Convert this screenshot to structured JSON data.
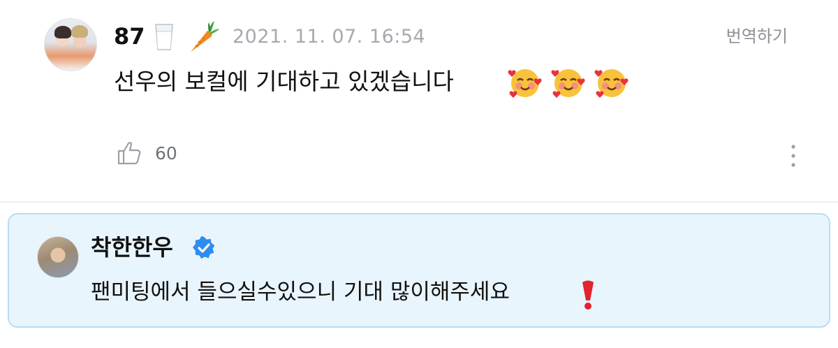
{
  "comment": {
    "author": "87",
    "author_emojis": [
      "milk-glass",
      "carrot"
    ],
    "timestamp": "2021. 11. 07. 16:54",
    "translate_label": "번역하기",
    "text": "선우의 보컬에 기대하고 있겠습니다",
    "text_emojis": [
      "smiling-face-with-hearts",
      "smiling-face-with-hearts",
      "smiling-face-with-hearts"
    ],
    "like_count": "60"
  },
  "reply": {
    "author": "착한한우",
    "verified": true,
    "text": "팬미팅에서 들으실수있으니 기대 많이해주세요",
    "text_emoji": "red-exclamation-mark"
  },
  "colors": {
    "reply_background": "#e9f5fd",
    "reply_border": "#b3ddf6",
    "verified_badge": "#2f8cf0",
    "timestamp": "#a6a9ae"
  }
}
